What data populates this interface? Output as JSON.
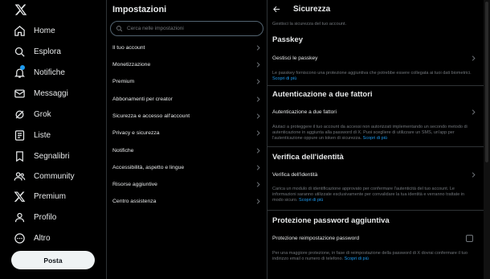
{
  "nav": {
    "items": [
      {
        "label": "Home",
        "icon": "home-icon"
      },
      {
        "label": "Esplora",
        "icon": "search-icon"
      },
      {
        "label": "Notifiche",
        "icon": "bell-icon"
      },
      {
        "label": "Messaggi",
        "icon": "mail-icon"
      },
      {
        "label": "Grok",
        "icon": "grok-icon"
      },
      {
        "label": "Liste",
        "icon": "list-icon"
      },
      {
        "label": "Segnalibri",
        "icon": "bookmark-icon"
      },
      {
        "label": "Community",
        "icon": "community-icon"
      },
      {
        "label": "Premium",
        "icon": "x-logo-icon"
      },
      {
        "label": "Profilo",
        "icon": "profile-icon"
      },
      {
        "label": "Altro",
        "icon": "more-icon"
      }
    ],
    "post_label": "Posta"
  },
  "settings": {
    "title": "Impostazioni",
    "search_placeholder": "Cerca nelle impostazioni",
    "items": [
      "Il tuo account",
      "Monetizzazione",
      "Premium",
      "Abbonamenti per creator",
      "Sicurezza e accesso all'account",
      "Privacy e sicurezza",
      "Notifiche",
      "Accessibilità, aspetto e lingue",
      "Risorse aggiuntive",
      "Centro assistenza"
    ]
  },
  "security": {
    "title": "Sicurezza",
    "subtitle": "Gestisci la sicurezza del tuo account.",
    "passkey": {
      "heading": "Passkey",
      "row": "Gestisci le passkey",
      "desc": "Le passkey forniscono una protezione aggiuntiva che potrebbe essere collegata ai tuoi dati biometrici.",
      "more": "Scopri di più"
    },
    "twofa": {
      "heading": "Autenticazione a due fattori",
      "row": "Autenticazione a due fattori",
      "desc": "Aiutaci a proteggere il tuo account da accessi non autorizzati implementando un secondo metodo di autenticazione in aggiunta alla password di X. Puoi scegliere di utilizzare un SMS, un'app per l'autenticazione oppure un token di sicurezza.",
      "more": "Scopri di più"
    },
    "identity": {
      "heading": "Verifica dell'identità",
      "row": "Verifica dell'identità",
      "desc": "Carica un modulo di identificazione approvato per confermare l'autenticità del tuo account. Le informazioni saranno utilizzate esclusivamente per convalidare la tua identità e verranno trattate in modo sicuro.",
      "more": "Scopri di più"
    },
    "password": {
      "heading": "Protezione password aggiuntiva",
      "row": "Protezione reimpostazione password",
      "checked": false,
      "desc": "Per una maggiore protezione, in fase di reimpostazione della password di X dovrai confermare il tuo indirizzo email o numero di telefono.",
      "more": "Scopri di più"
    }
  }
}
